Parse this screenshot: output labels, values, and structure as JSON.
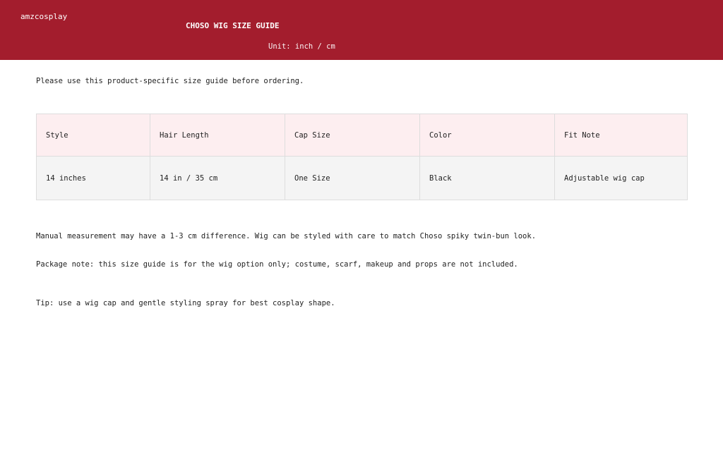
{
  "header": {
    "brand": "amzcosplay",
    "title": "CHOSO WIG SIZE GUIDE",
    "unit": "Unit: inch / cm",
    "background_color": "#a31d2d"
  },
  "intro": "Please use this product-specific size guide before ordering.",
  "table": {
    "columns": [
      "Style",
      "Hair Length",
      "Cap Size",
      "Color",
      "Fit Note"
    ],
    "rows": [
      [
        "14 inches",
        "14 in / 35 cm",
        "One Size",
        "Black",
        "Adjustable wig cap"
      ]
    ],
    "header_background": "#fdeef0",
    "row_background": "#f4f4f4"
  },
  "notes": [
    "Manual measurement may have a 1-3 cm difference. Wig can be styled with care to match Choso spiky twin-bun look.",
    "Package note: this size guide is for the wig option only; costume, scarf, makeup and props are not included.",
    "Tip: use a wig cap and gentle styling spray for best cosplay shape."
  ]
}
